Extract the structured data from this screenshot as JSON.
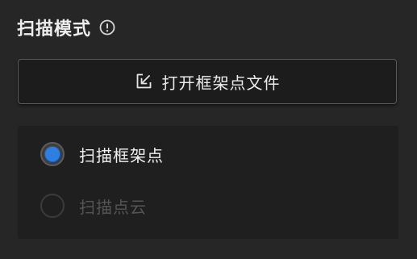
{
  "section": {
    "title": "扫描模式",
    "info_icon": "info-circle-icon"
  },
  "open_button": {
    "label": "打开框架点文件",
    "icon": "import-file-icon"
  },
  "scan_mode": {
    "selected": "扫描框架点",
    "options": [
      {
        "label": "扫描框架点",
        "checked": true,
        "disabled": false
      },
      {
        "label": "扫描点云",
        "checked": false,
        "disabled": true
      }
    ]
  },
  "colors": {
    "background": "#262626",
    "panel": "#1f1f1f",
    "accent": "#2f7fe0",
    "text": "#ececec",
    "disabled_text": "#555555"
  }
}
